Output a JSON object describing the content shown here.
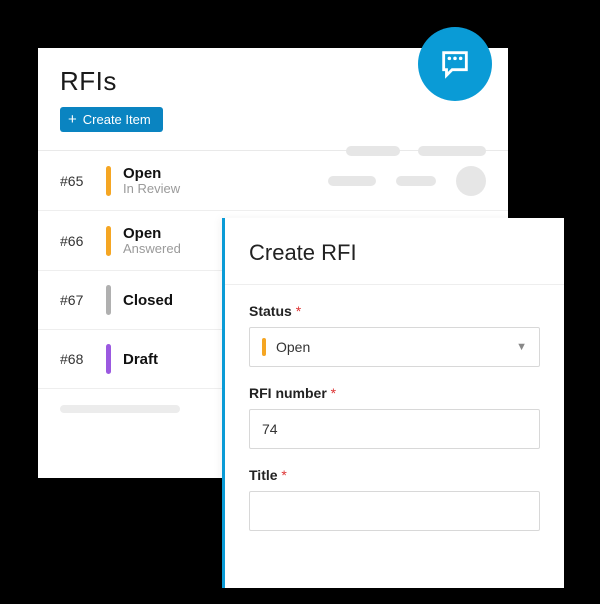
{
  "list_panel": {
    "title": "RFIs",
    "create_label": "Create Item",
    "rows": [
      {
        "id": "#65",
        "status": "Open",
        "sub": "In Review",
        "color": "c-open",
        "show_sub": true,
        "show_ph": true
      },
      {
        "id": "#66",
        "status": "Open",
        "sub": "Answered",
        "color": "c-open",
        "show_sub": true,
        "show_ph": true
      },
      {
        "id": "#67",
        "status": "Closed",
        "sub": "",
        "color": "c-closed",
        "show_sub": false,
        "show_ph": false
      },
      {
        "id": "#68",
        "status": "Draft",
        "sub": "",
        "color": "c-draft",
        "show_sub": false,
        "show_ph": false
      }
    ]
  },
  "form_panel": {
    "title": "Create RFI",
    "status_label": "Status",
    "status_value": "Open",
    "number_label": "RFI number",
    "number_value": "74",
    "title_label": "Title",
    "title_value": ""
  },
  "asterisk": "*"
}
